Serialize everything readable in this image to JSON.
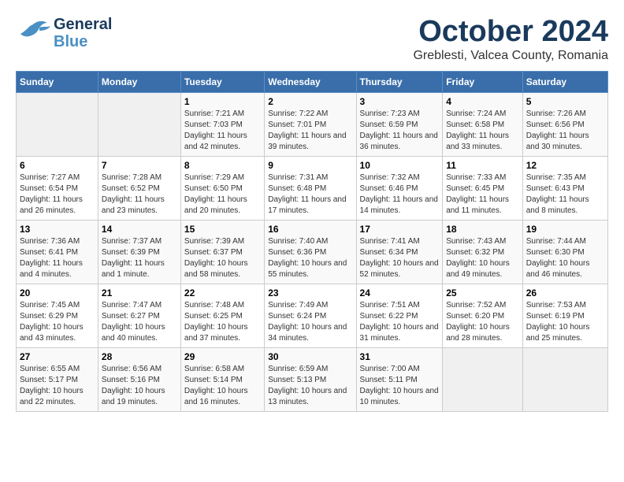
{
  "header": {
    "logo_line1": "General",
    "logo_line2": "Blue",
    "month": "October 2024",
    "location": "Greblesti, Valcea County, Romania"
  },
  "weekdays": [
    "Sunday",
    "Monday",
    "Tuesday",
    "Wednesday",
    "Thursday",
    "Friday",
    "Saturday"
  ],
  "weeks": [
    [
      {
        "day": "",
        "info": ""
      },
      {
        "day": "",
        "info": ""
      },
      {
        "day": "1",
        "info": "Sunrise: 7:21 AM\nSunset: 7:03 PM\nDaylight: 11 hours and 42 minutes."
      },
      {
        "day": "2",
        "info": "Sunrise: 7:22 AM\nSunset: 7:01 PM\nDaylight: 11 hours and 39 minutes."
      },
      {
        "day": "3",
        "info": "Sunrise: 7:23 AM\nSunset: 6:59 PM\nDaylight: 11 hours and 36 minutes."
      },
      {
        "day": "4",
        "info": "Sunrise: 7:24 AM\nSunset: 6:58 PM\nDaylight: 11 hours and 33 minutes."
      },
      {
        "day": "5",
        "info": "Sunrise: 7:26 AM\nSunset: 6:56 PM\nDaylight: 11 hours and 30 minutes."
      }
    ],
    [
      {
        "day": "6",
        "info": "Sunrise: 7:27 AM\nSunset: 6:54 PM\nDaylight: 11 hours and 26 minutes."
      },
      {
        "day": "7",
        "info": "Sunrise: 7:28 AM\nSunset: 6:52 PM\nDaylight: 11 hours and 23 minutes."
      },
      {
        "day": "8",
        "info": "Sunrise: 7:29 AM\nSunset: 6:50 PM\nDaylight: 11 hours and 20 minutes."
      },
      {
        "day": "9",
        "info": "Sunrise: 7:31 AM\nSunset: 6:48 PM\nDaylight: 11 hours and 17 minutes."
      },
      {
        "day": "10",
        "info": "Sunrise: 7:32 AM\nSunset: 6:46 PM\nDaylight: 11 hours and 14 minutes."
      },
      {
        "day": "11",
        "info": "Sunrise: 7:33 AM\nSunset: 6:45 PM\nDaylight: 11 hours and 11 minutes."
      },
      {
        "day": "12",
        "info": "Sunrise: 7:35 AM\nSunset: 6:43 PM\nDaylight: 11 hours and 8 minutes."
      }
    ],
    [
      {
        "day": "13",
        "info": "Sunrise: 7:36 AM\nSunset: 6:41 PM\nDaylight: 11 hours and 4 minutes."
      },
      {
        "day": "14",
        "info": "Sunrise: 7:37 AM\nSunset: 6:39 PM\nDaylight: 11 hours and 1 minute."
      },
      {
        "day": "15",
        "info": "Sunrise: 7:39 AM\nSunset: 6:37 PM\nDaylight: 10 hours and 58 minutes."
      },
      {
        "day": "16",
        "info": "Sunrise: 7:40 AM\nSunset: 6:36 PM\nDaylight: 10 hours and 55 minutes."
      },
      {
        "day": "17",
        "info": "Sunrise: 7:41 AM\nSunset: 6:34 PM\nDaylight: 10 hours and 52 minutes."
      },
      {
        "day": "18",
        "info": "Sunrise: 7:43 AM\nSunset: 6:32 PM\nDaylight: 10 hours and 49 minutes."
      },
      {
        "day": "19",
        "info": "Sunrise: 7:44 AM\nSunset: 6:30 PM\nDaylight: 10 hours and 46 minutes."
      }
    ],
    [
      {
        "day": "20",
        "info": "Sunrise: 7:45 AM\nSunset: 6:29 PM\nDaylight: 10 hours and 43 minutes."
      },
      {
        "day": "21",
        "info": "Sunrise: 7:47 AM\nSunset: 6:27 PM\nDaylight: 10 hours and 40 minutes."
      },
      {
        "day": "22",
        "info": "Sunrise: 7:48 AM\nSunset: 6:25 PM\nDaylight: 10 hours and 37 minutes."
      },
      {
        "day": "23",
        "info": "Sunrise: 7:49 AM\nSunset: 6:24 PM\nDaylight: 10 hours and 34 minutes."
      },
      {
        "day": "24",
        "info": "Sunrise: 7:51 AM\nSunset: 6:22 PM\nDaylight: 10 hours and 31 minutes."
      },
      {
        "day": "25",
        "info": "Sunrise: 7:52 AM\nSunset: 6:20 PM\nDaylight: 10 hours and 28 minutes."
      },
      {
        "day": "26",
        "info": "Sunrise: 7:53 AM\nSunset: 6:19 PM\nDaylight: 10 hours and 25 minutes."
      }
    ],
    [
      {
        "day": "27",
        "info": "Sunrise: 6:55 AM\nSunset: 5:17 PM\nDaylight: 10 hours and 22 minutes."
      },
      {
        "day": "28",
        "info": "Sunrise: 6:56 AM\nSunset: 5:16 PM\nDaylight: 10 hours and 19 minutes."
      },
      {
        "day": "29",
        "info": "Sunrise: 6:58 AM\nSunset: 5:14 PM\nDaylight: 10 hours and 16 minutes."
      },
      {
        "day": "30",
        "info": "Sunrise: 6:59 AM\nSunset: 5:13 PM\nDaylight: 10 hours and 13 minutes."
      },
      {
        "day": "31",
        "info": "Sunrise: 7:00 AM\nSunset: 5:11 PM\nDaylight: 10 hours and 10 minutes."
      },
      {
        "day": "",
        "info": ""
      },
      {
        "day": "",
        "info": ""
      }
    ]
  ]
}
